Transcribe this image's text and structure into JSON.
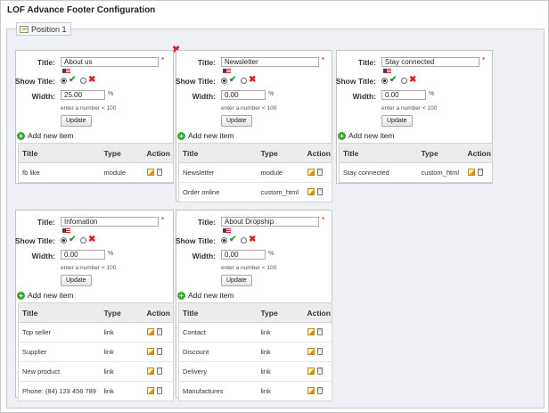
{
  "page": {
    "title": "LOF Advance Footer Configuration"
  },
  "position": {
    "label": "Position 1"
  },
  "labels": {
    "title": "Title:",
    "show_title": "Show Title:",
    "width": "Width:",
    "hint": "enter a number < 100",
    "unit": "%",
    "required": "*",
    "update": "Update",
    "add_item": "Add new item",
    "col_title": "Title",
    "col_type": "Type",
    "col_action": "Action"
  },
  "icons": {
    "close": "close-icon",
    "flag": "us-flag-icon",
    "yes": "check-icon",
    "no": "cross-icon",
    "add": "add-icon",
    "edit": "edit-icon",
    "delete": "delete-icon",
    "legend": "window-icon"
  },
  "colors": {
    "background": "#eef0f6",
    "check": "#2a9a2a",
    "cross": "#d22222",
    "add": "#3aa63a"
  },
  "panels": [
    {
      "title": "About us",
      "width": "25.00",
      "show_title": "yes",
      "items": [
        {
          "title": "fb like",
          "type": "module"
        }
      ]
    },
    {
      "title": "Newsletter",
      "width": "0.00",
      "show_title": "yes",
      "items": [
        {
          "title": "Newsletter",
          "type": "module"
        },
        {
          "title": "Order online",
          "type": "custom_html"
        }
      ]
    },
    {
      "title": "Stay connected",
      "width": "0.00",
      "show_title": "yes",
      "items": [
        {
          "title": "Stay connected",
          "type": "custom_html"
        }
      ]
    },
    {
      "title": "Infomation",
      "width": "0.00",
      "show_title": "yes",
      "items": [
        {
          "title": "Top seller",
          "type": "link"
        },
        {
          "title": "Supplier",
          "type": "link"
        },
        {
          "title": "New product",
          "type": "link"
        },
        {
          "title": "Phone: (84) 123 456 789",
          "type": "link"
        }
      ]
    },
    {
      "title": "About Dropship",
      "width": "0.00",
      "show_title": "yes",
      "items": [
        {
          "title": "Contact",
          "type": "link"
        },
        {
          "title": "Discount",
          "type": "link"
        },
        {
          "title": "Delivery",
          "type": "link"
        },
        {
          "title": "Manufactures",
          "type": "link"
        }
      ]
    }
  ]
}
